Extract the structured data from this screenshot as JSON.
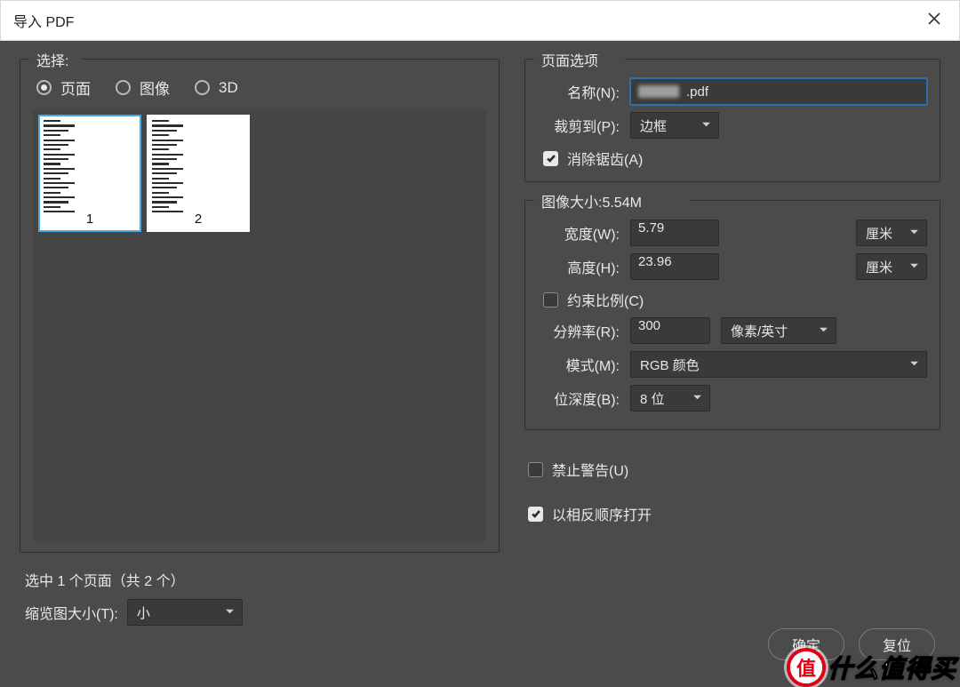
{
  "window": {
    "title": "导入 PDF"
  },
  "select_group": {
    "legend": "选择:",
    "radios": {
      "pages": "页面",
      "images": "图像",
      "threeD": "3D"
    },
    "selected": "pages",
    "thumbs": [
      {
        "num": "1",
        "selected": true
      },
      {
        "num": "2",
        "selected": false
      }
    ],
    "status": "选中 1 个页面（共 2 个）",
    "thumb_size_label": "缩览图大小(T):",
    "thumb_size_value": "小"
  },
  "page_options": {
    "legend": "页面选项",
    "name_label": "名称(N):",
    "name_value": ".pdf",
    "crop_label": "裁剪到(P):",
    "crop_value": "边框",
    "antialias_label": "消除锯齿(A)",
    "antialias_checked": true
  },
  "image_size": {
    "legend_prefix": "图像大小:",
    "size_text": "5.54M",
    "width_label": "宽度(W):",
    "width_value": "5.79",
    "width_unit": "厘米",
    "height_label": "高度(H):",
    "height_value": "23.96",
    "height_unit": "厘米",
    "constrain_label": "约束比例(C)",
    "constrain_checked": false,
    "resolution_label": "分辨率(R):",
    "resolution_value": "300",
    "resolution_unit": "像素/英寸",
    "mode_label": "模式(M):",
    "mode_value": "RGB 颜色",
    "bitdepth_label": "位深度(B):",
    "bitdepth_value": "8 位"
  },
  "misc": {
    "suppress_warnings_label": "禁止警告(U)",
    "suppress_warnings_checked": false,
    "reverse_order_label": "以相反顺序打开",
    "reverse_order_checked": true
  },
  "buttons": {
    "ok": "确定",
    "reset": "复位"
  },
  "watermark": {
    "badge": "值",
    "text": "什么值得买"
  }
}
